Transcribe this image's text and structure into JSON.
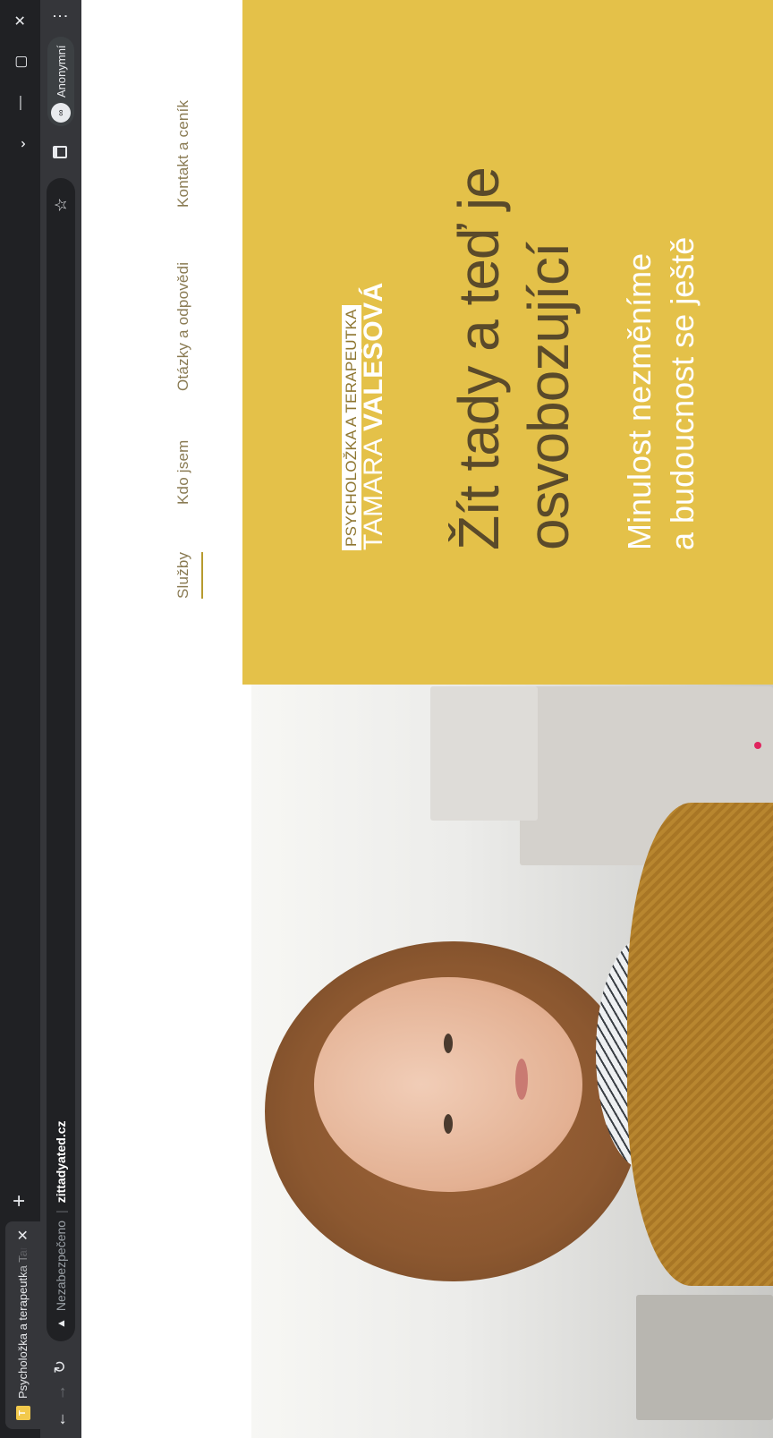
{
  "browser": {
    "tab_title": "Psycholožka a terapeutka Tamara",
    "new_tab": "+",
    "min": "—",
    "restore": "▢",
    "close": "✕",
    "chevron": "⌄",
    "back": "←",
    "forward": "→",
    "reload": "↻",
    "warning_glyph": "▲",
    "insecure_label": "Nezabezpečeno",
    "separator": "|",
    "domain": "zittadyated.cz",
    "star": "☆",
    "profile_label": "Anonymní",
    "profile_avatar": "∞",
    "menu": "⋮"
  },
  "nav": {
    "items": [
      "Služby",
      "Kdo jsem",
      "Otázky a odpovědi",
      "Kontakt a ceník"
    ],
    "active_index": 0
  },
  "hero": {
    "badge": "PSYCHOLOŽKA A TERAPEUTKA",
    "name_first": "TAMARA",
    "name_last": "VALEŠOVÁ",
    "headline_1": "Žít tady a teď je",
    "headline_2": "osvobozující",
    "subline_1": "Minulost nezměníme",
    "subline_2": "a budoucnost se ještě"
  },
  "colors": {
    "accent_yellow": "#e4c149",
    "nav_text": "#8a7b53",
    "headline_text": "#5a4a2a"
  }
}
